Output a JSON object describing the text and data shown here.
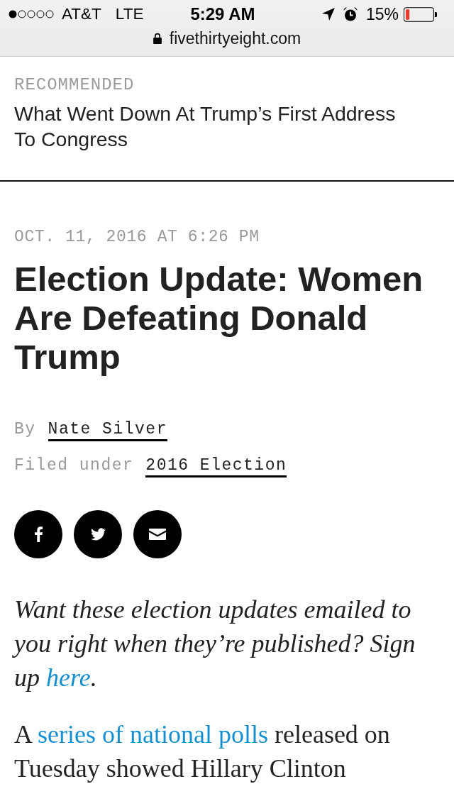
{
  "status_bar": {
    "carrier": "AT&T",
    "network": "LTE",
    "time": "5:29 AM",
    "battery": "15%"
  },
  "address_bar": {
    "url": "fivethirtyeight.com"
  },
  "recommended": {
    "label": "RECOMMENDED",
    "headline": "What Went Down At Trump’s First Address To Congress"
  },
  "article": {
    "date": "OCT. 11, 2016 AT 6:26 PM",
    "title": "Election Update: Women Are Defeating Donald Trump",
    "byline": [
      {
        "label": "By",
        "link": "Nate Silver"
      },
      {
        "label": "Filed under",
        "link": "2016 Election"
      }
    ],
    "share_buttons": [
      {
        "kind": "facebook"
      },
      {
        "kind": "twitter"
      },
      {
        "kind": "email"
      }
    ],
    "paragraphs": [
      {
        "kind": "italic",
        "text_before": "Want these election updates emailed to you right when they’re published? Sign up ",
        "link": "here",
        "text_after": "."
      },
      {
        "kind": "plain",
        "text_before": "A ",
        "link": "series of national polls",
        "text_after": " released on Tuesday showed Hillary Clinton"
      }
    ]
  }
}
